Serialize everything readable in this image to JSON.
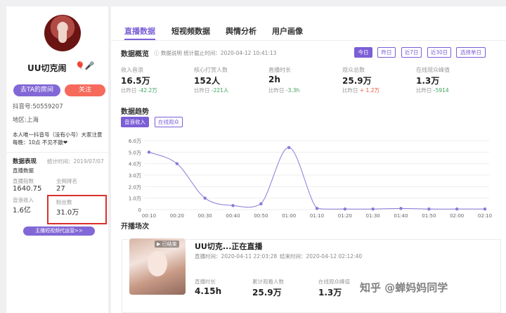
{
  "profile": {
    "nickname": "UU切克闹",
    "nick_icons": "🎈🎤",
    "room_button": "去TA的房间",
    "follow_button": "关注",
    "douyin_id": "抖音号:50559207",
    "region": "地区:上海",
    "desc_line1": "本人唯一抖音号（没有小号）大家注意",
    "desc_line2": "每晚：10点 不见不散❤"
  },
  "stats": {
    "title": "数据表现",
    "time": "统计时间：2019/07/07",
    "subtitle": "直播数据",
    "items": [
      {
        "label": "直播指数",
        "value": "1640.75"
      },
      {
        "label": "全网排名",
        "value": "27"
      },
      {
        "label": "音浪收入",
        "value": "1.6亿"
      },
      {
        "label": "粉丝数",
        "value": "31.0万"
      }
    ],
    "promo_button": "主播短视频代运营>>"
  },
  "tabs": [
    "直播数据",
    "短视频数据",
    "舆情分析",
    "用户画像"
  ],
  "overview": {
    "title": "数据概览",
    "info": "数据说明 统计截止时间：2020-04-12 10:41:13",
    "ranges": [
      "今日",
      "昨日",
      "近7日",
      "近30日",
      "选择单日"
    ],
    "metrics": [
      {
        "label": "收入音浪",
        "value": "16.5万",
        "cmp_prefix": "比昨日",
        "cmp": "-42.2万",
        "trend": "down"
      },
      {
        "label": "核心打赏人数",
        "value": "152人",
        "cmp_prefix": "比昨日",
        "cmp": "-221人",
        "trend": "down"
      },
      {
        "label": "直播时长",
        "value": "2h",
        "cmp_prefix": "比昨日",
        "cmp": "-3.3h",
        "trend": "down"
      },
      {
        "label": "观众总数",
        "value": "25.9万",
        "cmp_prefix": "比昨日",
        "cmp": "+ 1.2万",
        "trend": "up"
      },
      {
        "label": "在线观众峰值",
        "value": "1.3万",
        "cmp_prefix": "比昨日",
        "cmp": "-5914",
        "trend": "down"
      }
    ]
  },
  "trend": {
    "title": "数据趋势",
    "toggles": [
      "音浪收入",
      "在线观众"
    ]
  },
  "chart_data": {
    "type": "line",
    "x": [
      "00:10",
      "00:20",
      "00:30",
      "00:40",
      "00:50",
      "01:00",
      "01:10",
      "01:20",
      "01:30",
      "01:40",
      "01:50",
      "02:00",
      "02:10"
    ],
    "series": [
      {
        "values": [
          5.0,
          4.0,
          1.0,
          0.35,
          0.5,
          5.4,
          0.1,
          0.05,
          0.05,
          0.1,
          0.05,
          0.05,
          0.05
        ]
      }
    ],
    "y_ticks": [
      "6.0万",
      "5.0万",
      "4.0万",
      "3.0万",
      "2.0万",
      "1.0万",
      "0"
    ],
    "ylim": [
      0,
      6
    ],
    "color": "#8a78d8",
    "grid": true
  },
  "sessions": {
    "title": "开播场次",
    "replay_badge": "已结束",
    "room_title": "UU切克...正在直播",
    "start_time": "直播时间：2020-04-11 22:03:28",
    "end_time": "结束时间：2020-04-12 02:12:40",
    "stats": [
      {
        "label": "直播时长",
        "value": "4.15h"
      },
      {
        "label": "累计观看人数",
        "value": "25.9万"
      },
      {
        "label": "在线观众峰值",
        "value": "1.3万"
      }
    ]
  },
  "watermark": "知乎 @蝉妈妈同学"
}
